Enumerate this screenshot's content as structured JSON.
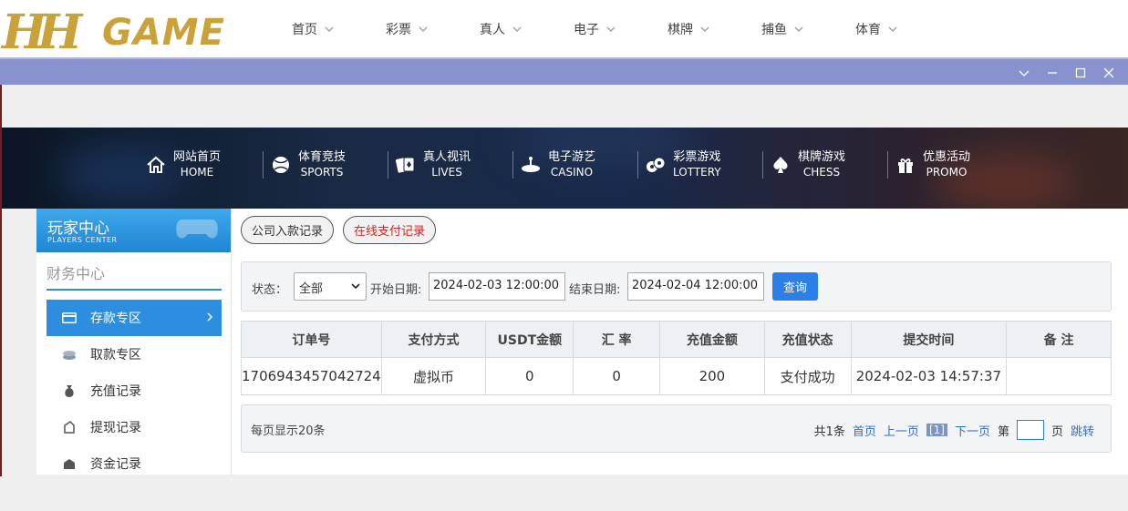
{
  "logo": {
    "hh": "HH",
    "game": "GAME"
  },
  "topnav": [
    "首页",
    "彩票",
    "真人",
    "电子",
    "棋牌",
    "捕鱼",
    "体育"
  ],
  "banner_nav": [
    {
      "zh": "网站首页",
      "en": "HOME",
      "icon": "home-icon"
    },
    {
      "zh": "体育竞技",
      "en": "SPORTS",
      "icon": "ball-icon"
    },
    {
      "zh": "真人视讯",
      "en": "LIVES",
      "icon": "cards-icon"
    },
    {
      "zh": "电子游艺",
      "en": "CASINO",
      "icon": "roulette-icon"
    },
    {
      "zh": "彩票游戏",
      "en": "LOTTERY",
      "icon": "lottery-balls-icon"
    },
    {
      "zh": "棋牌游戏",
      "en": "CHESS",
      "icon": "spade-icon"
    },
    {
      "zh": "优惠活动",
      "en": "PROMO",
      "icon": "gift-icon"
    }
  ],
  "sidebar": {
    "title": "玩家中心",
    "subtitle": "PLAYERS CENTER",
    "section": "财务中心",
    "items": [
      {
        "label": "存款专区",
        "icon": "card-icon",
        "active": true
      },
      {
        "label": "取款专区",
        "icon": "coins-icon",
        "active": false
      },
      {
        "label": "充值记录",
        "icon": "money-bag-icon",
        "active": false
      },
      {
        "label": "提现记录",
        "icon": "withdraw-icon",
        "active": false
      },
      {
        "label": "资金记录",
        "icon": "fund-icon",
        "active": false
      }
    ]
  },
  "tabs": {
    "company": "公司入款记录",
    "online": "在线支付记录"
  },
  "filter": {
    "status_label": "状态：",
    "status_value": "全部",
    "start_label": "开始日期:",
    "start_value": "2024-02-03 12:00:00",
    "end_label": "结束日期:",
    "end_value": "2024-02-04 12:00:00",
    "query": "查询"
  },
  "table": {
    "headers": [
      "订单号",
      "支付方式",
      "USDT金额",
      "汇 率",
      "充值金额",
      "充值状态",
      "提交时间",
      "备 注"
    ],
    "rows": [
      [
        "1706943457042724",
        "虚拟币",
        "0",
        "0",
        "200",
        "支付成功",
        "2024-02-03 14:57:37",
        ""
      ]
    ]
  },
  "pager": {
    "per_page": "每页显示20条",
    "total": "共1条",
    "first": "首页",
    "prev": "上一页",
    "current": "[1]",
    "next": "下一页",
    "page_prefix": "第",
    "page_suffix": "页",
    "jump": "跳转"
  },
  "colors": {
    "accent": "#2d8ee0",
    "online_tab_text": "#e02020",
    "titlebar": "#8792cf",
    "gold": "#c9a23a"
  }
}
